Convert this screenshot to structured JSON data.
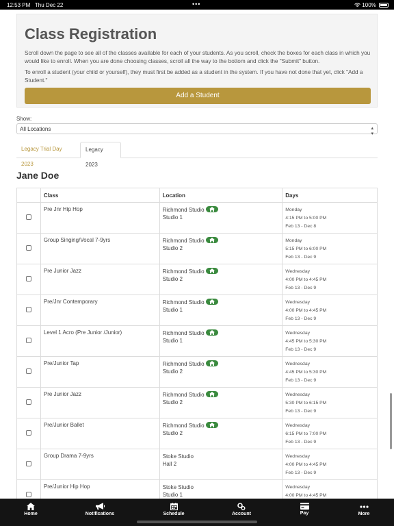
{
  "status_bar": {
    "time": "12:53 PM",
    "date": "Thu Dec 22",
    "battery": "100%"
  },
  "header": {
    "title": "Class Registration",
    "intro": "Scroll down the page to see all of the classes available for each of your students. As you scroll, check the boxes for each class in which you would like to enroll. When you are done choosing classes, scroll all the way to the bottom and click the \"Submit\" button.",
    "enroll_note": "To enroll a student (your child or yourself), they must first be added as a student in the system. If you have not done that yet, click \"Add a Student.\"",
    "add_student_label": "Add a Student"
  },
  "filter": {
    "show_label": "Show:",
    "location_value": "All Locations"
  },
  "tabs": [
    {
      "label": "Legacy Trial Day 2023",
      "active": false
    },
    {
      "label": "Legacy 2023",
      "active": true
    }
  ],
  "student": {
    "name": "Jane Doe"
  },
  "table": {
    "headers": [
      "Class",
      "Location",
      "Days"
    ],
    "rows": [
      {
        "class": "Pre Jnr Hip Hop",
        "studio": "Richmond Studio",
        "home": true,
        "room": "Studio 1",
        "day": "Monday",
        "time": "4:15 PM to 5:00 PM",
        "dates": "Feb 13 - Dec 8"
      },
      {
        "class": "Group Singing/Vocal 7-9yrs",
        "studio": "Richmond Studio",
        "home": true,
        "room": "Studio 2",
        "day": "Monday",
        "time": "5:15 PM to 6:00 PM",
        "dates": "Feb 13 - Dec 9"
      },
      {
        "class": "Pre Junior Jazz",
        "studio": "Richmond Studio",
        "home": true,
        "room": "Studio 2",
        "day": "Wednesday",
        "time": "4:00 PM to 4:45 PM",
        "dates": "Feb 13 - Dec 9"
      },
      {
        "class": "Pre/Jnr Contemporary",
        "studio": "Richmond Studio",
        "home": true,
        "room": "Studio 1",
        "day": "Wednesday",
        "time": "4:00 PM to 4:45 PM",
        "dates": "Feb 13 - Dec 9"
      },
      {
        "class": "Level 1 Acro (Pre Junior /Junior)",
        "studio": "Richmond Studio",
        "home": true,
        "room": "Studio 1",
        "day": "Wednesday",
        "time": "4:45 PM to 5:30 PM",
        "dates": "Feb 13 - Dec 9"
      },
      {
        "class": "Pre/Junior Tap",
        "studio": "Richmond Studio",
        "home": true,
        "room": "Studio 2",
        "day": "Wednesday",
        "time": "4:45 PM to 5:30 PM",
        "dates": "Feb 13 - Dec 9"
      },
      {
        "class": "Pre Junior Jazz",
        "studio": "Richmond Studio",
        "home": true,
        "room": "Studio 2",
        "day": "Wednesday",
        "time": "5:30 PM to 6:15 PM",
        "dates": "Feb 13 - Dec 9"
      },
      {
        "class": "Pre/Junior Ballet",
        "studio": "Richmond Studio",
        "home": true,
        "room": "Studio 2",
        "day": "Wednesday",
        "time": "6:15 PM to 7:00 PM",
        "dates": "Feb 13 - Dec 9"
      },
      {
        "class": "Group Drama 7-9yrs",
        "studio": "Stoke Studio",
        "home": false,
        "room": "Hall 2",
        "day": "Wednesday",
        "time": "4:00 PM to 4:45 PM",
        "dates": "Feb 13 - Dec 9"
      },
      {
        "class": "Pre/Junior Hip Hop",
        "studio": "Stoke Studio",
        "home": false,
        "room": "Studio 1",
        "day": "Wednesday",
        "time": "4:00 PM to 4:45 PM",
        "dates": "Feb 13 - Dec 9"
      }
    ]
  },
  "bottom_nav": [
    {
      "label": "Home",
      "icon": "home-icon"
    },
    {
      "label": "Notifications",
      "icon": "megaphone-icon"
    },
    {
      "label": "Schedule",
      "icon": "calendar-icon"
    },
    {
      "label": "Account",
      "icon": "gears-icon"
    },
    {
      "label": "Pay",
      "icon": "credit-card-icon"
    },
    {
      "label": "More",
      "icon": "ellipsis-icon"
    }
  ],
  "colors": {
    "accent": "#b8973d",
    "badge": "#3a8a3e",
    "nav_bg": "#141414"
  }
}
